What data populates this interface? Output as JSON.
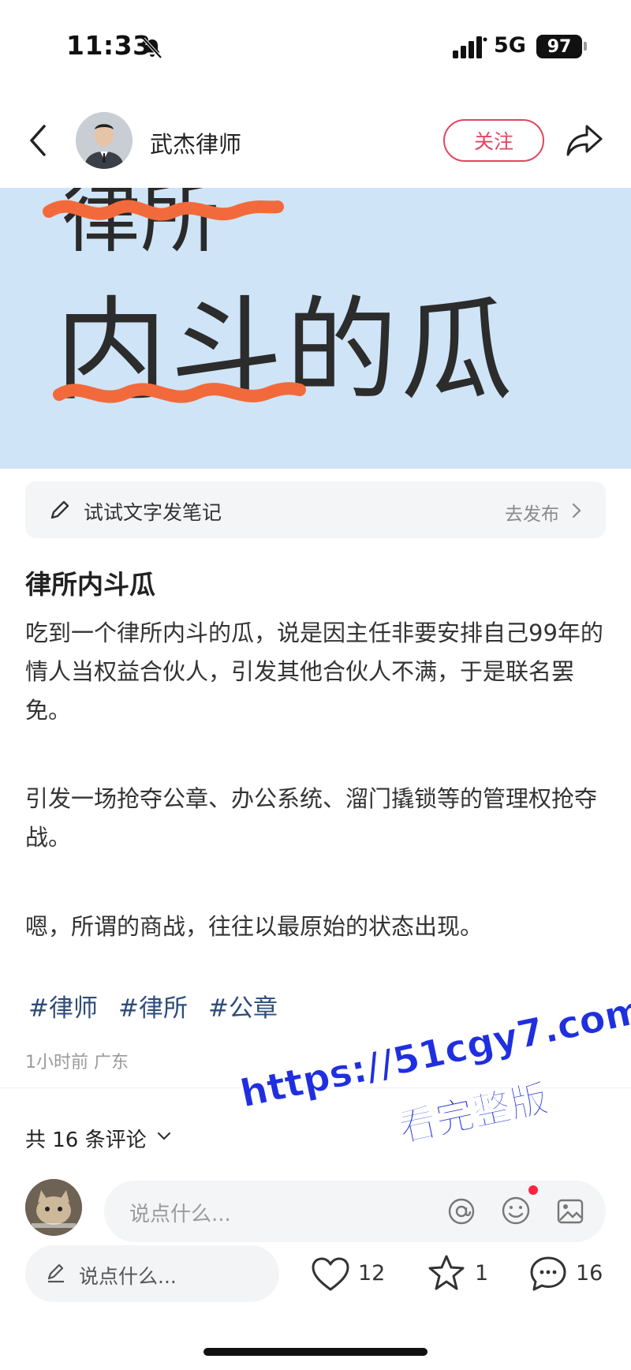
{
  "status_bar": {
    "time": "11:33",
    "network": "5G",
    "battery": "97"
  },
  "header": {
    "author_name": "武杰律师",
    "follow_label": "关注"
  },
  "hero": {
    "partial_text": "律所",
    "main_text": "内斗的瓜",
    "underline_color": "#f26a3c",
    "background": "#cfe4f6"
  },
  "try_note": {
    "label": "试试文字发笔记",
    "action": "去发布"
  },
  "post": {
    "title": "律所内斗瓜",
    "paragraphs": [
      "吃到一个律所内斗的瓜，说是因主任非要安排自己99年的情人当权益合伙人，引发其他合伙人不满，于是联名罢免。",
      "引发一场抢夺公章、办公系统、溜门撬锁等的管理权抢夺战。",
      "嗯，所谓的商战，往往以最原始的状态出现。"
    ],
    "tags": [
      "#律师",
      "#律所",
      "#公章"
    ],
    "meta": "1小时前 广东"
  },
  "watermark": {
    "line1": "https://51cgy7.com",
    "line2": "看完整版"
  },
  "comments": {
    "count_label": "共 16 条评论",
    "input_placeholder": "说点什么..."
  },
  "bottom_bar": {
    "input_placeholder": "说点什么...",
    "likes": "12",
    "stars": "1",
    "comments": "16"
  },
  "colors": {
    "accent": "#e2465f",
    "tag": "#2e4c7c",
    "watermark": "#1f2fe0"
  }
}
